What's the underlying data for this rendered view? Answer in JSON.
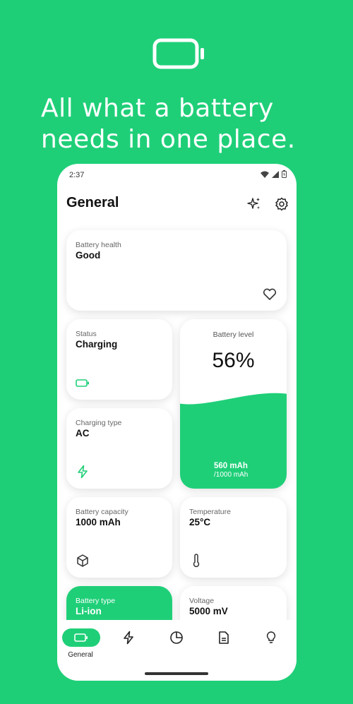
{
  "hero": {
    "headline": "All what a battery needs in one place.",
    "icon": "battery-icon"
  },
  "status_bar": {
    "time": "2:37",
    "icons": [
      "wifi-icon",
      "signal-icon",
      "battery-charging-icon"
    ]
  },
  "page": {
    "title": "General",
    "actions": [
      "sparkle-icon",
      "settings-gear-icon"
    ]
  },
  "cards": {
    "health": {
      "label": "Battery health",
      "value": "Good",
      "icon": "heart-icon"
    },
    "status": {
      "label": "Status",
      "value": "Charging",
      "icon": "battery-icon"
    },
    "charging_type": {
      "label": "Charging type",
      "value": "AC",
      "icon": "lightning-icon"
    },
    "level": {
      "label": "Battery level",
      "percent": "56%",
      "current": "560 mAh",
      "total": "/1000 mAh",
      "fraction": 0.56
    },
    "capacity": {
      "label": "Battery capacity",
      "value": "1000 mAh",
      "icon": "cube-icon"
    },
    "temperature": {
      "label": "Temperature",
      "value": "25°C",
      "icon": "thermometer-icon"
    },
    "type": {
      "label": "Battery type",
      "value": "Li-ion"
    },
    "voltage": {
      "label": "Voltage",
      "value": "5000 mV"
    }
  },
  "nav": {
    "items": [
      {
        "label": "General",
        "icon": "battery-icon",
        "active": true
      },
      {
        "icon": "lightning-icon"
      },
      {
        "icon": "pie-chart-icon"
      },
      {
        "icon": "document-icon"
      },
      {
        "icon": "lightbulb-icon"
      }
    ]
  },
  "colors": {
    "accent": "#1fcf78",
    "card": "#ffffff",
    "text": "#111111"
  }
}
